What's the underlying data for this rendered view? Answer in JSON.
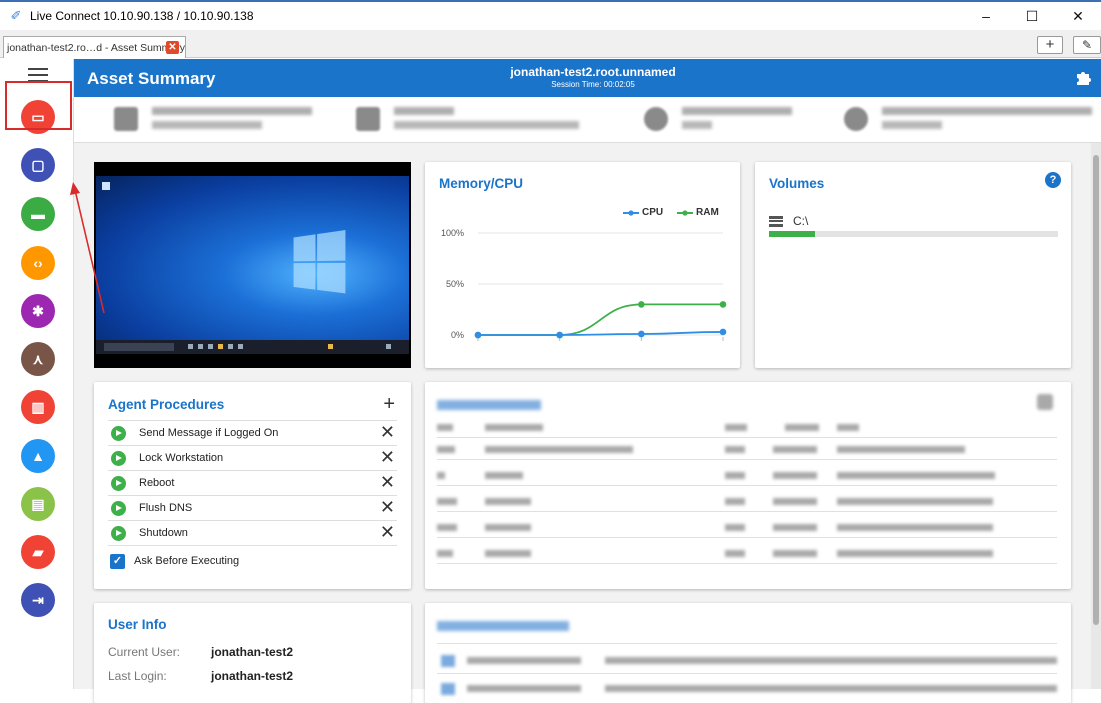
{
  "window": {
    "title": "Live Connect  10.10.90.138 / 10.10.90.138",
    "minimize": "–",
    "maximize": "☐",
    "close": "✕"
  },
  "tabs": [
    {
      "label": "jonathan-test2.ro…d - Asset Summary",
      "close": "✕"
    }
  ],
  "tab_actions": {
    "add": "+",
    "edit": "✎"
  },
  "sidebar": {
    "items": [
      {
        "icon": "devices-icon",
        "color": "#f04336"
      },
      {
        "icon": "remote-desktop-icon",
        "color": "#3f51b5"
      },
      {
        "icon": "folder-icon",
        "color": "#3aac43"
      },
      {
        "icon": "code-icon",
        "color": "#ff9800"
      },
      {
        "icon": "gear-icon",
        "color": "#9c27b0"
      },
      {
        "icon": "network-icon",
        "color": "#795548"
      },
      {
        "icon": "book-icon",
        "color": "#f04336"
      },
      {
        "icon": "warning-icon",
        "color": "#2196f3"
      },
      {
        "icon": "clipboard-icon",
        "color": "#8bc34a"
      },
      {
        "icon": "chat-icon",
        "color": "#f04336"
      },
      {
        "icon": "logout-icon",
        "color": "#3f51b5"
      }
    ]
  },
  "header": {
    "title": "Asset Summary",
    "machine": "jonathan-test2.root.unnamed",
    "session": "Session Time: 00:02:05",
    "accent": "#1a74c9"
  },
  "memory_cpu": {
    "title": "Memory/CPU",
    "legend_cpu": "CPU",
    "legend_ram": "RAM",
    "colors": {
      "cpu": "#2f8ee6",
      "ram": "#3db049"
    }
  },
  "chart_data": {
    "type": "line",
    "x": [
      1,
      2,
      3,
      4
    ],
    "series": [
      {
        "name": "CPU",
        "values": [
          0,
          0,
          1,
          3
        ]
      },
      {
        "name": "RAM",
        "values": [
          0,
          0,
          30,
          30
        ]
      }
    ],
    "ylim": [
      0,
      100
    ],
    "yticks": [
      "100%",
      "50%",
      "0%"
    ],
    "grid": true,
    "legend": "top-right"
  },
  "volumes": {
    "title": "Volumes",
    "help": "?",
    "drive": "C:\\",
    "used_fraction": 0.16
  },
  "procedures": {
    "title": "Agent Procedures",
    "add": "+",
    "items": [
      {
        "label": "Send Message if Logged On",
        "remove": "✕"
      },
      {
        "label": "Lock Workstation",
        "remove": "✕"
      },
      {
        "label": "Reboot",
        "remove": "✕"
      },
      {
        "label": "Flush DNS",
        "remove": "✕"
      },
      {
        "label": "Shutdown",
        "remove": "✕"
      }
    ],
    "ask_label": "Ask Before Executing",
    "ask_checked": "✓"
  },
  "user_info": {
    "title": "User Info",
    "rows": [
      {
        "key": "Current User:",
        "value": "jonathan-test2"
      },
      {
        "key": "Last Login:",
        "value": "jonathan-test2"
      }
    ]
  }
}
